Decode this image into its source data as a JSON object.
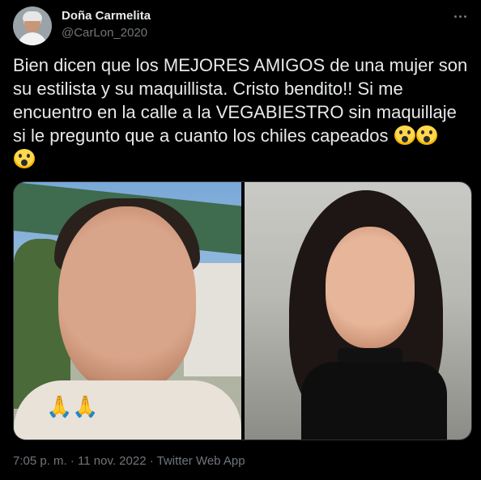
{
  "user": {
    "display_name": "Doña Carmelita",
    "handle": "@CarLon_2020"
  },
  "tweet": {
    "text": "Bien dicen que los MEJORES AMIGOS de una mujer son su estilista y su maquillista. Cristo bendito!! Si me encuentro en la calle a la VEGABIESTRO sin maquillaje si le pregunto que a cuanto los chiles capeados",
    "emojis": [
      "face-screaming-in-fear",
      "face-screaming-in-fear",
      "face-screaming-in-fear"
    ],
    "media": {
      "left_overlay_emoji": "🙏🙏"
    },
    "footer": "7:05 p. m. · 11 nov. 2022 · Twitter Web App"
  },
  "icons": {
    "more": "more-options-icon"
  },
  "colors": {
    "background": "#000000",
    "text": "#e7e9ea",
    "secondary_text": "#71767b",
    "border": "#2f3336"
  }
}
